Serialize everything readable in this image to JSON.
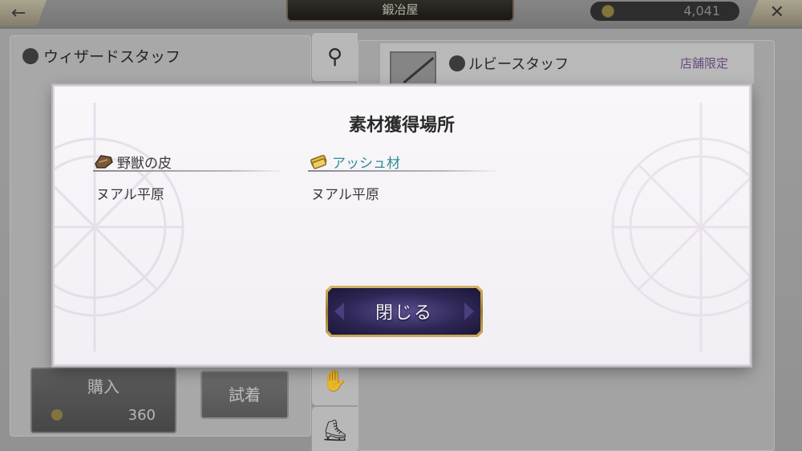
{
  "background": {
    "title": "鍛冶屋",
    "coins": "4,041",
    "left_item_name": "ウィザードスタッフ",
    "right_item_name": "ルビースタッフ",
    "shop_limited": "店舗限定",
    "buy_label": "購入",
    "buy_price": "360",
    "try_on_label": "試着"
  },
  "modal": {
    "title": "素材獲得場所",
    "materials": [
      {
        "name": "野獣の皮",
        "location": "ヌアル平原",
        "icon": "leather-icon",
        "color": "#3a3a3a"
      },
      {
        "name": "アッシュ材",
        "location": "ヌアル平原",
        "icon": "wood-icon",
        "color": "#2f8a9a"
      }
    ],
    "close_label": "閉じる"
  }
}
